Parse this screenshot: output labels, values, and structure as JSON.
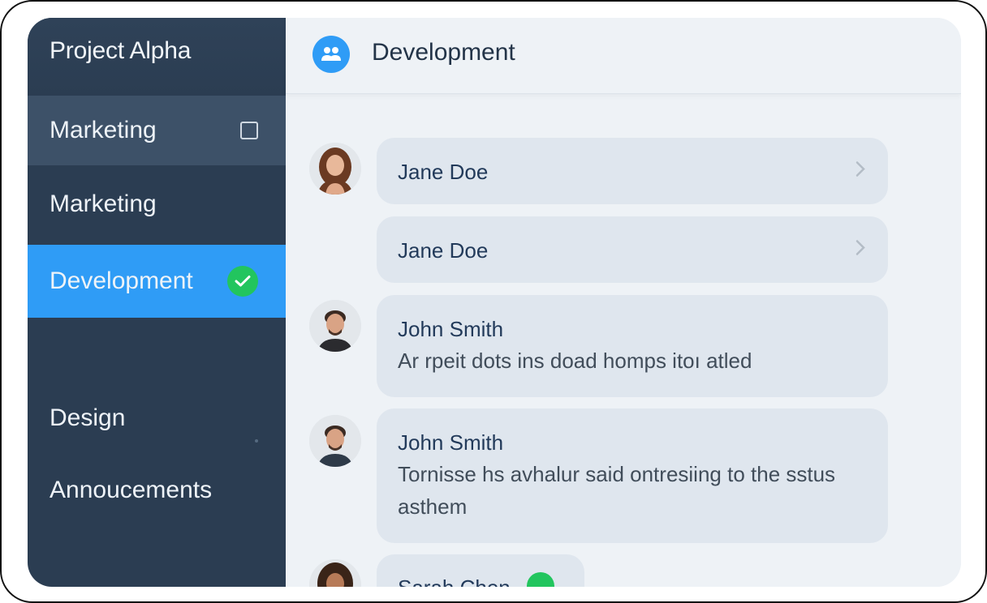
{
  "sidebar": {
    "workspace": "Project Alpha",
    "items": [
      {
        "label": "Marketing"
      },
      {
        "label": "Marketing"
      },
      {
        "label": "Development"
      },
      {
        "label": "Design"
      },
      {
        "label": "Annoucements"
      }
    ],
    "active_color": "#2f9cf6"
  },
  "header": {
    "title": "Development",
    "icon": "team-icon"
  },
  "messages": [
    {
      "name": "Jane Doe",
      "text": ""
    },
    {
      "name": "Jane Doe",
      "text": ""
    },
    {
      "name": "John Smith",
      "text": "Ar rpeit dots ins doad homps itoı atled"
    },
    {
      "name": "John Smith",
      "text": "Tornisse hs avhalur said ontresiing to the sstus asthem"
    },
    {
      "name": "Sarah Chen",
      "text": ""
    }
  ],
  "colors": {
    "sidebar_bg": "#2b3d52",
    "accent": "#2f9cf6",
    "online": "#22c55e"
  }
}
